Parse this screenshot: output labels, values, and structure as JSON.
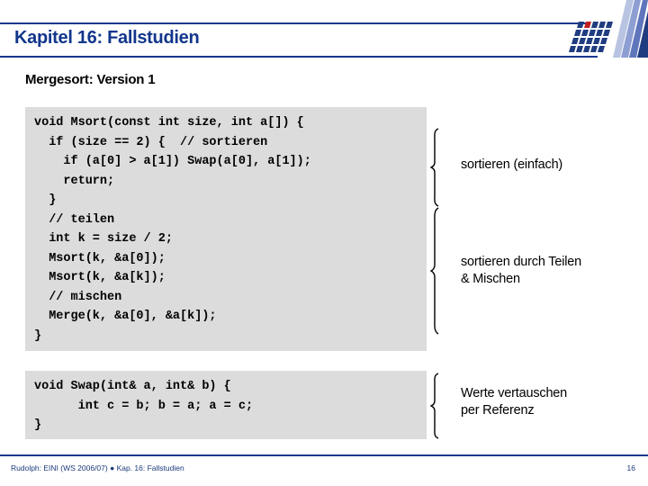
{
  "slide": {
    "title": "Kapitel 16: Fallstudien",
    "subtitle": "Mergesort: Version 1"
  },
  "colors": {
    "title_blue": "#12368c",
    "logo_dark_blue": "#1f3c80",
    "logo_mid_blue": "#6b82c4",
    "logo_light_blue": "#b9c4e2",
    "logo_accent_red": "#c02020",
    "code_background": "#dcdcdc",
    "footer_text": "#1b3a7a"
  },
  "logo": {
    "name": "university-logo",
    "description": "diagonal-stripes-and-tile-grid"
  },
  "code_blocks": [
    {
      "id": "msort",
      "name": "code-block-msort",
      "text": "void Msort(const int size, int a[]) {\n  if (size == 2) {  // sortieren\n    if (a[0] > a[1]) Swap(a[0], a[1]);\n    return;\n  }\n  // teilen\n  int k = size / 2;\n  Msort(k, &a[0]);\n  Msort(k, &a[k]);\n  // mischen\n  Merge(k, &a[0], &a[k]);\n}"
    },
    {
      "id": "swap",
      "name": "code-block-swap",
      "text": "void Swap(int& a, int& b) {\n      int c = b; b = a; a = c;\n}"
    }
  ],
  "annotations": [
    {
      "id": "einfach",
      "text": "sortieren (einfach)"
    },
    {
      "id": "teilen",
      "text": "sortieren durch Teilen\n& Mischen"
    },
    {
      "id": "vertauschen",
      "text": "Werte vertauschen\nper Referenz"
    }
  ],
  "footer": {
    "text": "Rudolph: EINI (WS 2006/07)  ●  Kap. 16: Fallstudien",
    "page": "16"
  }
}
